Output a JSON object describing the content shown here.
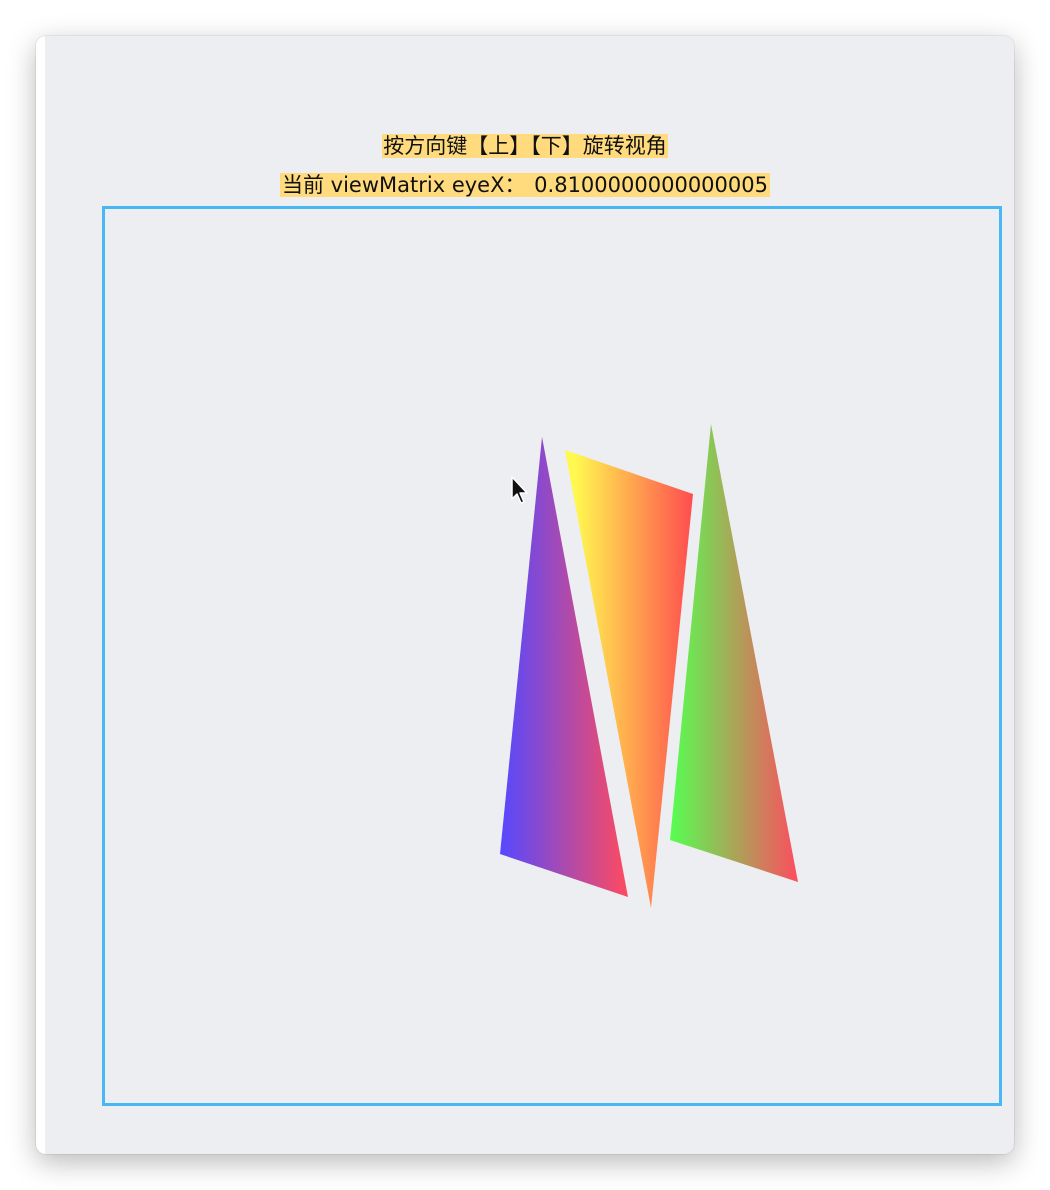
{
  "instructions": "按方向键【上】【下】旋转视角",
  "eye_label": "当前 viewMatrix eyeX：",
  "eye_value": "0.8100000000000005",
  "triangles": [
    {
      "name": "blue",
      "colors": [
        "#5549ff",
        "#ff4a5f"
      ]
    },
    {
      "name": "yellow",
      "colors": [
        "#fff94f",
        "#ff4c4f"
      ]
    },
    {
      "name": "green",
      "colors": [
        "#56ff52",
        "#ff4a5f"
      ]
    }
  ]
}
